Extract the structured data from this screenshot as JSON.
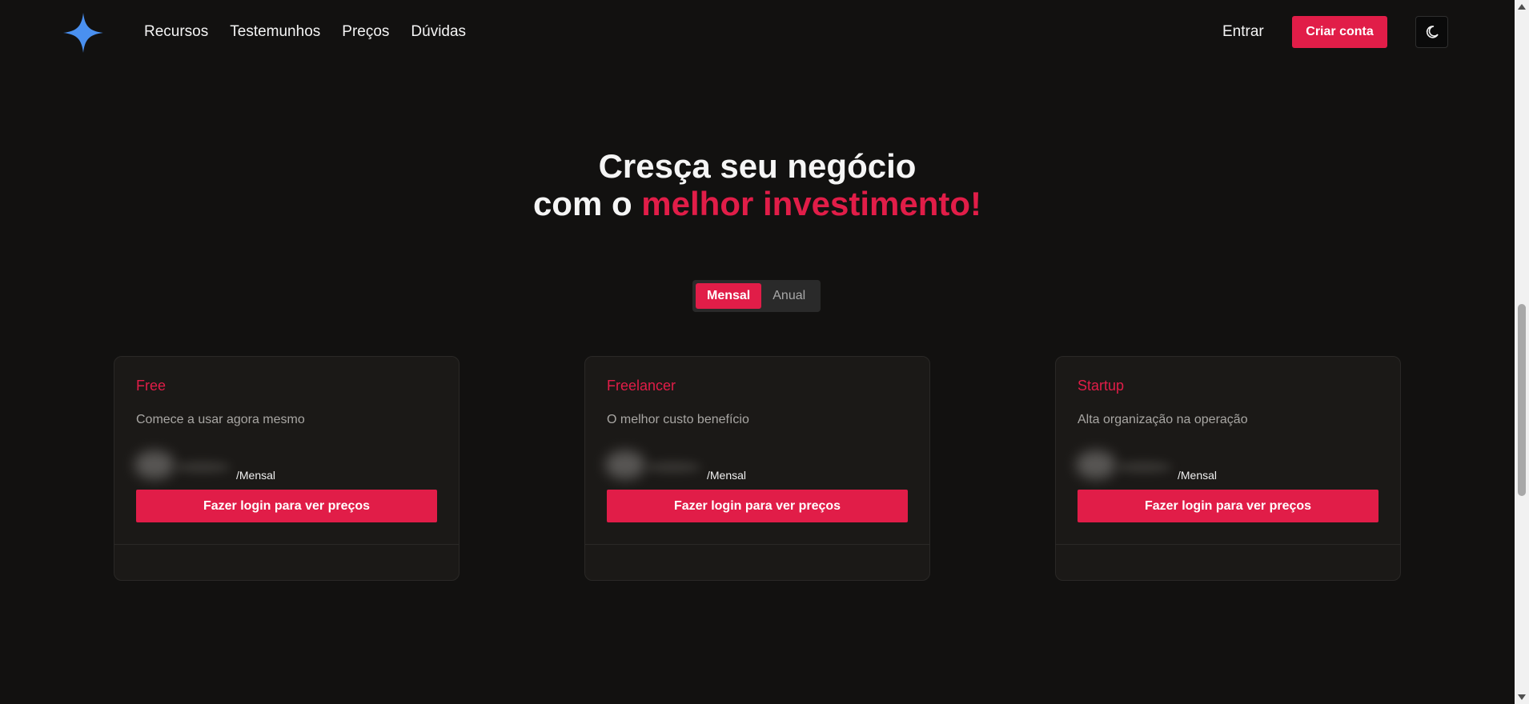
{
  "nav": {
    "items": [
      "Recursos",
      "Testemunhos",
      "Preços",
      "Dúvidas"
    ],
    "signin_label": "Entrar",
    "cta_label": "Criar conta",
    "theme_icon": "moon-stars-icon"
  },
  "hero": {
    "line1": "Cresça seu negócio",
    "line2_prefix": "com o ",
    "line2_accent": "melhor investimento!"
  },
  "billing_toggle": {
    "options": [
      "Mensal",
      "Anual"
    ],
    "selected": "Mensal"
  },
  "plans": [
    {
      "name": "Free",
      "description": "Comece a usar agora mesmo",
      "period": "/Mensal",
      "button_label": "Fazer login para ver preços"
    },
    {
      "name": "Freelancer",
      "description": "O melhor custo benefício",
      "period": "/Mensal",
      "button_label": "Fazer login para ver preços"
    },
    {
      "name": "Startup",
      "description": "Alta organização na operação",
      "period": "/Mensal",
      "button_label": "Fazer login para ver preços"
    }
  ],
  "colors": {
    "accent": "#e11d48",
    "background": "#121110",
    "card": "#1b1917",
    "logo": "#4a90f0"
  }
}
